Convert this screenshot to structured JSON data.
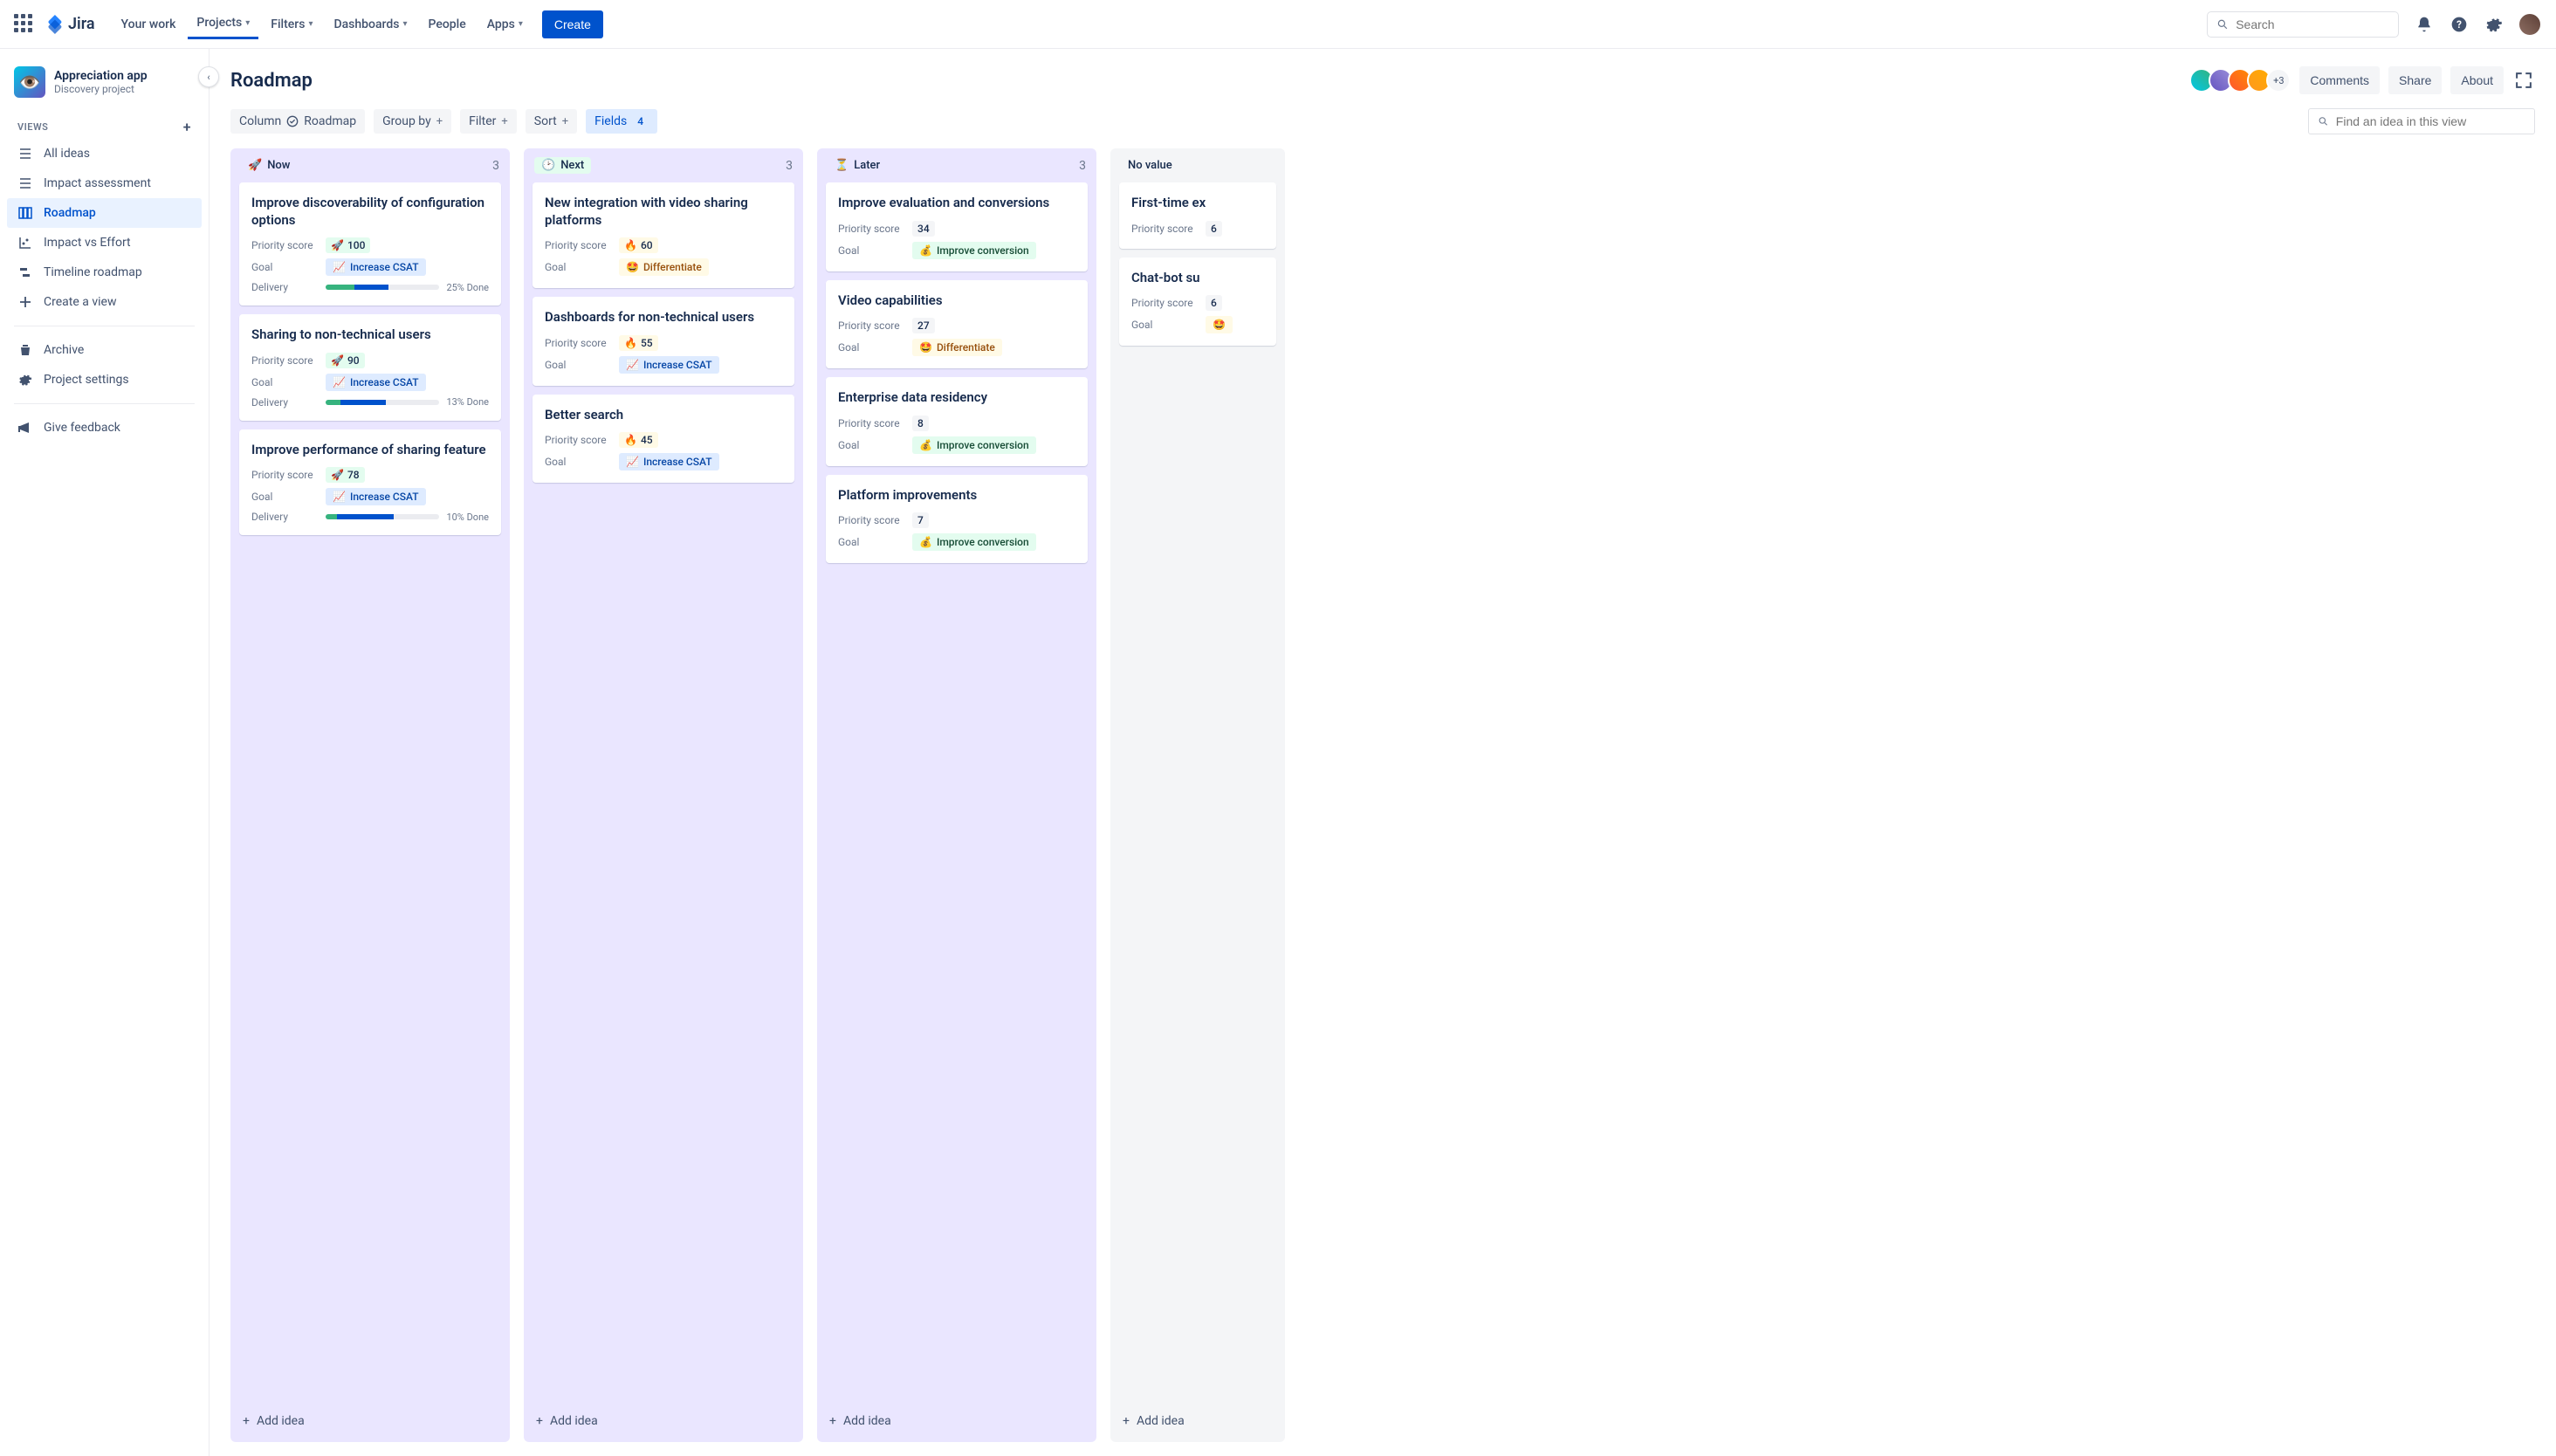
{
  "nav": {
    "logo": "Jira",
    "your_work": "Your work",
    "projects": "Projects",
    "filters": "Filters",
    "dashboards": "Dashboards",
    "people": "People",
    "apps": "Apps",
    "create": "Create",
    "search_placeholder": "Search"
  },
  "sidebar": {
    "project_name": "Appreciation app",
    "project_type": "Discovery project",
    "views_label": "VIEWS",
    "items": {
      "all_ideas": "All ideas",
      "impact_assessment": "Impact assessment",
      "roadmap": "Roadmap",
      "impact_vs_effort": "Impact vs Effort",
      "timeline_roadmap": "Timeline roadmap",
      "create_view": "Create a view",
      "archive": "Archive",
      "project_settings": "Project settings",
      "give_feedback": "Give feedback"
    }
  },
  "header": {
    "title": "Roadmap",
    "avatars_more": "+3",
    "comments": "Comments",
    "share": "Share",
    "about": "About"
  },
  "toolbar": {
    "column": "Column",
    "column_value": "Roadmap",
    "group_by": "Group by",
    "filter": "Filter",
    "sort": "Sort",
    "fields": "Fields",
    "fields_count": "4",
    "find_placeholder": "Find an idea in this view"
  },
  "labels": {
    "priority": "Priority score",
    "goal": "Goal",
    "delivery": "Delivery",
    "add_idea": "Add idea"
  },
  "goals": {
    "csat": "Increase CSAT",
    "differentiate": "Differentiate",
    "conversion": "Improve conversion"
  },
  "columns": [
    {
      "key": "now",
      "emoji": "🚀",
      "label": "Now",
      "count": "3",
      "cards": [
        {
          "title": "Improve discoverability of configuration options",
          "prio": "100",
          "prio_style": "green",
          "prio_emoji": "🚀",
          "goal": "csat",
          "delivery_done": 25,
          "delivery_prog": 30,
          "delivery_label": "25% Done"
        },
        {
          "title": "Sharing to non-technical users",
          "prio": "90",
          "prio_style": "green",
          "prio_emoji": "🚀",
          "goal": "csat",
          "delivery_done": 13,
          "delivery_prog": 40,
          "delivery_label": "13% Done"
        },
        {
          "title": "Improve performance of sharing feature",
          "prio": "78",
          "prio_style": "green",
          "prio_emoji": "🚀",
          "goal": "csat",
          "delivery_done": 10,
          "delivery_prog": 50,
          "delivery_label": "10% Done"
        }
      ]
    },
    {
      "key": "next",
      "emoji": "🕑",
      "label": "Next",
      "count": "3",
      "cards": [
        {
          "title": "New integration with video sharing platforms",
          "prio": "60",
          "prio_style": "fire",
          "prio_emoji": "🔥",
          "goal": "differentiate"
        },
        {
          "title": "Dashboards for non-technical users",
          "prio": "55",
          "prio_style": "fire",
          "prio_emoji": "🔥",
          "goal": "csat"
        },
        {
          "title": "Better search",
          "prio": "45",
          "prio_style": "fire",
          "prio_emoji": "🔥",
          "goal": "csat"
        }
      ]
    },
    {
      "key": "later",
      "emoji": "⏳",
      "label": "Later",
      "count": "3",
      "cards": [
        {
          "title": "Improve evaluation and conversions",
          "prio": "34",
          "prio_style": "gray",
          "prio_emoji": "",
          "goal": "conversion"
        },
        {
          "title": "Video capabilities",
          "prio": "27",
          "prio_style": "gray",
          "prio_emoji": "",
          "goal": "differentiate"
        },
        {
          "title": "Enterprise data residency",
          "prio": "8",
          "prio_style": "gray",
          "prio_emoji": "",
          "goal": "conversion"
        },
        {
          "title": "Platform improvements",
          "prio": "7",
          "prio_style": "gray",
          "prio_emoji": "",
          "goal": "conversion"
        }
      ]
    },
    {
      "key": "novalue",
      "emoji": "",
      "label": "No value",
      "count": "",
      "cards": [
        {
          "title": "First-time ex",
          "prio": "6",
          "prio_style": "gray",
          "prio_emoji": ""
        },
        {
          "title": "Chat-bot su",
          "prio": "6",
          "prio_style": "gray",
          "prio_emoji": "",
          "goal": "differentiate",
          "goal_partial": true
        }
      ]
    }
  ]
}
